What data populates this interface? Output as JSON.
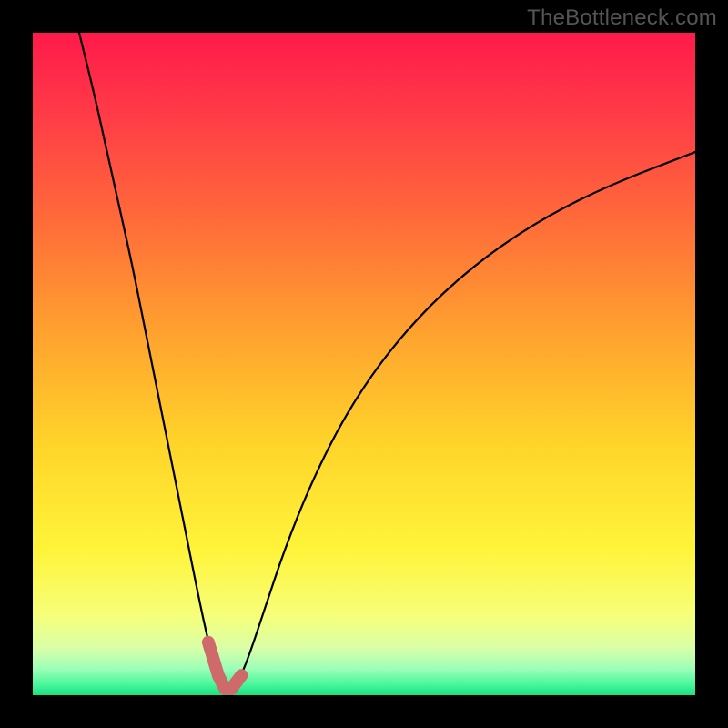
{
  "watermark": "TheBottleneck.com",
  "gradient": {
    "stops": [
      {
        "pct": 0,
        "color": "#ff1a4b"
      },
      {
        "pct": 12,
        "color": "#ff3a47"
      },
      {
        "pct": 28,
        "color": "#ff6a3a"
      },
      {
        "pct": 45,
        "color": "#ffa12f"
      },
      {
        "pct": 62,
        "color": "#ffd42a"
      },
      {
        "pct": 78,
        "color": "#fff43a"
      },
      {
        "pct": 88,
        "color": "#f6ff7a"
      },
      {
        "pct": 93,
        "color": "#d8ffa8"
      },
      {
        "pct": 96,
        "color": "#9cffb8"
      },
      {
        "pct": 98.5,
        "color": "#46f59a"
      },
      {
        "pct": 100,
        "color": "#18e07e"
      }
    ]
  },
  "highlight_color": "#cf6a6a",
  "curve_color": "#000000",
  "chart_data": {
    "type": "line",
    "title": "",
    "xlabel": "",
    "ylabel": "",
    "xlim": [
      0,
      100
    ],
    "ylim": [
      0,
      100
    ],
    "series": [
      {
        "name": "bottleneck-curve",
        "x": [
          7,
          9,
          11,
          13,
          15,
          17,
          19,
          21,
          23,
          25,
          26.5,
          28,
          29,
          30,
          31.5,
          33,
          35,
          38,
          42,
          47,
          53,
          60,
          68,
          77,
          87,
          100
        ],
        "y": [
          100,
          92,
          83,
          74,
          65,
          55,
          45,
          35,
          25,
          15,
          8,
          3,
          1,
          1,
          3,
          7,
          13,
          22,
          32,
          42,
          51,
          59,
          66,
          72,
          77,
          82
        ]
      }
    ],
    "annotations": [
      {
        "name": "highlight-dip",
        "x_start": 26.5,
        "x_end": 31.5
      }
    ]
  }
}
